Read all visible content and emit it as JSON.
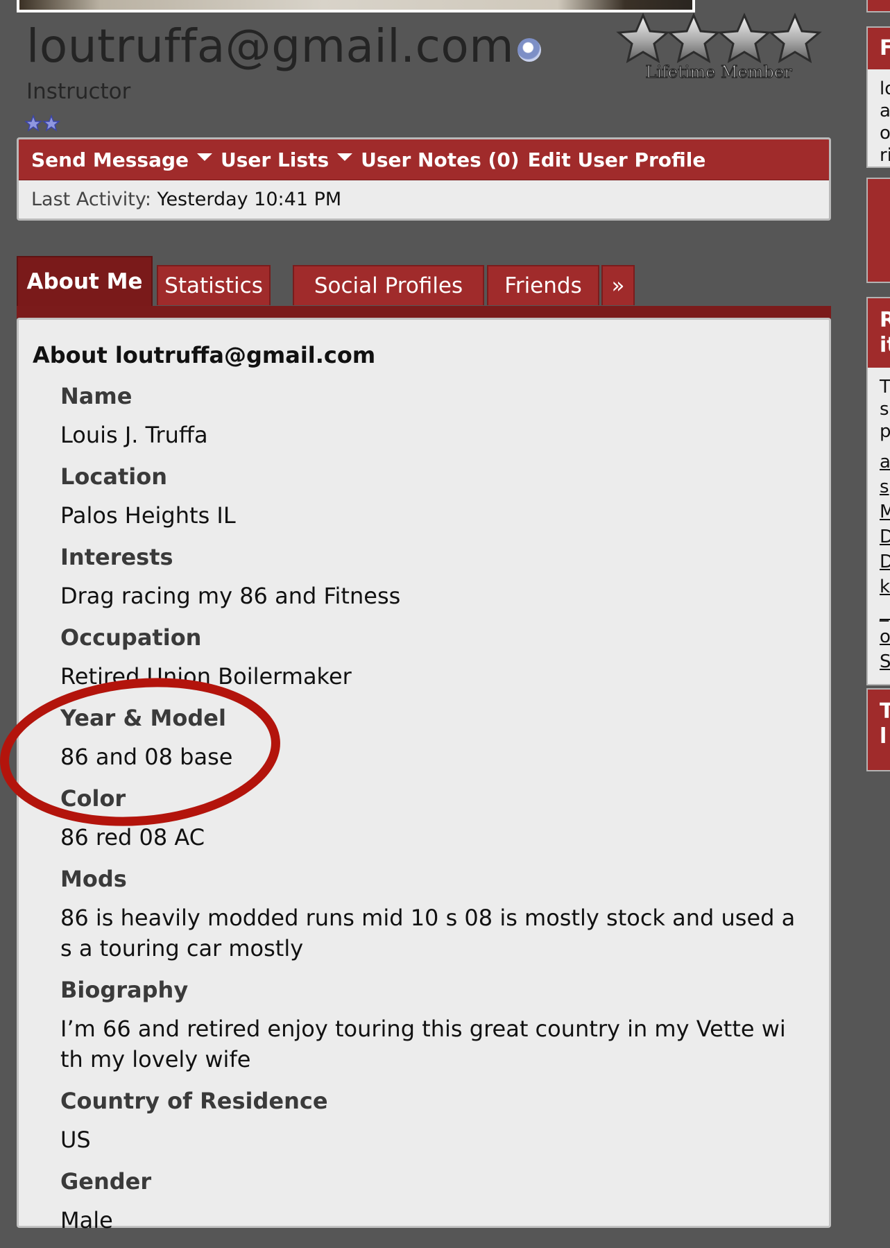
{
  "profile": {
    "username": "loutruffa@gmail.com",
    "user_title": "Instructor",
    "badge_text": "Lifetime Member"
  },
  "member_actions": {
    "send_message": "Send Message",
    "user_lists": "User Lists",
    "user_notes": "User Notes (0)",
    "edit_profile": "Edit User Profile"
  },
  "activity": {
    "label": "Last Activity:",
    "value": "Yesterday 10:41 PM"
  },
  "tabs": [
    {
      "label": "About Me",
      "active": true
    },
    {
      "label": "Statistics",
      "active": false
    },
    {
      "label": "Social Profiles",
      "active": false
    },
    {
      "label": "Friends",
      "active": false
    },
    {
      "label": "»",
      "active": false
    }
  ],
  "about": {
    "heading": "About loutruffa@gmail.com",
    "fields": [
      {
        "label": "Name",
        "value": "Louis J. Truffa"
      },
      {
        "label": "Location",
        "value": "Palos Heights IL"
      },
      {
        "label": "Interests",
        "value": "Drag racing my 86 and Fitness"
      },
      {
        "label": "Occupation",
        "value": "Retired Union Boilermaker"
      },
      {
        "label": "Year & Model",
        "value": "86 and 08 base"
      },
      {
        "label": "Color",
        "value": "86 red 08 AC"
      },
      {
        "label": "Mods",
        "value": "86 is heavily modded runs mid 10 s 08 is mostly stock and used a\ns a touring car mostly"
      },
      {
        "label": "Biography",
        "value": "I’m 66 and retired enjoy touring this great country in my Vette wi\nth my lovely wife"
      },
      {
        "label": "Country of Residence",
        "value": "US"
      },
      {
        "label": "Gender",
        "value": "Male"
      }
    ]
  },
  "sidebar": {
    "box1_header": "F",
    "box1_lines": [
      "lo",
      "a",
      "o",
      "ri"
    ],
    "box2_header_lines": [
      "R",
      "it"
    ],
    "box2_text": [
      "T",
      "s",
      "p"
    ],
    "box2_links": [
      "a",
      "s",
      "M",
      "D",
      "D",
      "k",
      "_1",
      "o",
      "S"
    ],
    "box3_header_lines": [
      "T",
      "l"
    ]
  },
  "colors": {
    "page_bg": "#565656",
    "accent_red": "#a02b2b",
    "dark_red": "#7a1a1a",
    "panel_bg": "#ececec",
    "annotation_red": "#b3140c"
  }
}
